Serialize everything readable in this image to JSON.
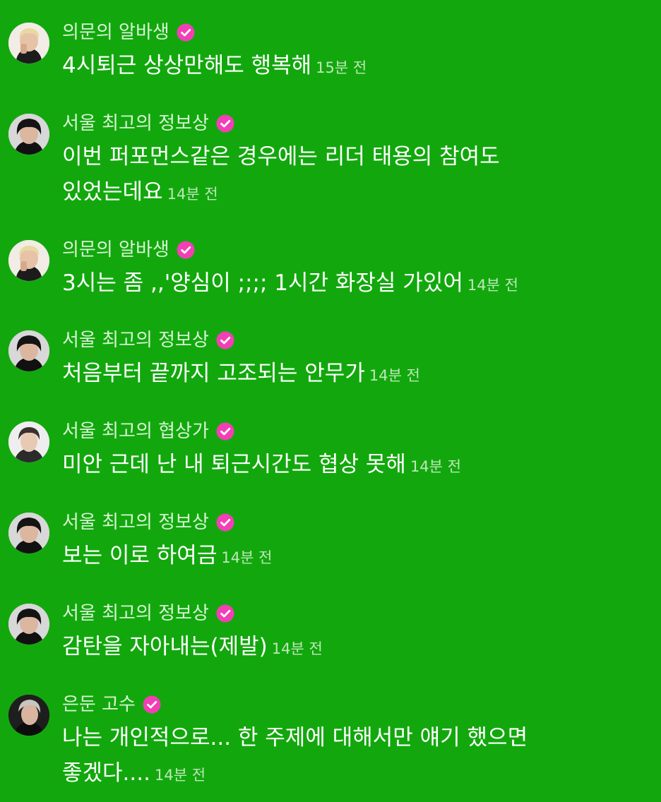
{
  "colors": {
    "background": "#12a80d",
    "verified_badge": "#f23fb6",
    "username": "#d9f3d6",
    "message": "#ffffff",
    "timestamp": "#bfe6bb"
  },
  "messages": [
    {
      "user": "의문의 알바생",
      "verified": true,
      "avatar": "avatar-photo-blonde",
      "text": "4시퇴근 상상만해도 행복해",
      "time": "15분 전"
    },
    {
      "user": "서울 최고의 정보상",
      "verified": true,
      "avatar": "avatar-photo-dark-hair",
      "text": "이번 퍼포먼스같은 경우에는 리더 태용의 참여도\n있었는데요",
      "time": "14분 전"
    },
    {
      "user": "의문의 알바생",
      "verified": true,
      "avatar": "avatar-photo-blonde",
      "text": "3시는 좀 ,,'양심이 ;;;; 1시간 화장실 가있어",
      "time": "14분 전"
    },
    {
      "user": "서울 최고의 정보상",
      "verified": true,
      "avatar": "avatar-photo-dark-hair",
      "text": "처음부터 끝까지 고조되는 안무가",
      "time": "14분 전"
    },
    {
      "user": "서울 최고의 협상가",
      "verified": true,
      "avatar": "avatar-photo-light-bg",
      "text": "미안 근데 난 내 퇴근시간도 협상 못해",
      "time": "14분 전"
    },
    {
      "user": "서울 최고의 정보상",
      "verified": true,
      "avatar": "avatar-photo-dark-hair",
      "text": "보는 이로 하여금",
      "time": "14분 전"
    },
    {
      "user": "서울 최고의 정보상",
      "verified": true,
      "avatar": "avatar-photo-dark-hair",
      "text": "감탄을 자아내는(제발)",
      "time": "14분 전"
    },
    {
      "user": "은둔 고수",
      "verified": true,
      "avatar": "avatar-photo-silver-hair",
      "text": "나는 개인적으로... 한 주제에 대해서만 얘기 했으면\n좋겠다....",
      "time": "14분 전"
    }
  ]
}
